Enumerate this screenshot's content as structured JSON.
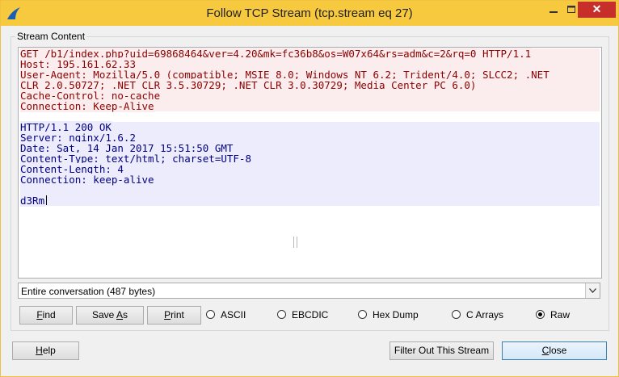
{
  "window": {
    "title": "Follow TCP Stream (tcp.stream eq 27)",
    "close_glyph": "✕",
    "accent": "#f7c93e",
    "close_color": "#c7302a"
  },
  "stream": {
    "group_label": "Stream Content",
    "client_color": "#8b0000",
    "server_color": "#000080",
    "client_lines": [
      "GET /b1/index.php?uid=69868464&ver=4.20&mk=fc36b8&os=W07x64&rs=adm&c=2&rq=0 HTTP/1.1",
      "Host: 195.161.62.33",
      "User-Agent: Mozilla/5.0 (compatible; MSIE 8.0; Windows NT 6.2; Trident/4.0; SLCC2; .NET",
      "CLR 2.0.50727; .NET CLR 3.5.30729; .NET CLR 3.0.30729; Media Center PC 6.0)",
      "Cache-Control: no-cache",
      "Connection: Keep-Alive"
    ],
    "server_lines": [
      "HTTP/1.1 200 OK",
      "Server: nginx/1.6.2",
      "Date: Sat, 14 Jan 2017 15:51:50 GMT",
      "Content-Type: text/html; charset=UTF-8",
      "Content-Length: 4",
      "Connection: keep-alive"
    ],
    "server_body": "d3Rm"
  },
  "conversation_select": {
    "value": "Entire conversation (487 bytes)"
  },
  "buttons": {
    "find": {
      "pre": "",
      "key": "F",
      "post": "ind"
    },
    "save_as": {
      "pre": "Save ",
      "key": "A",
      "post": "s"
    },
    "print": {
      "pre": "",
      "key": "P",
      "post": "rint"
    },
    "help": {
      "pre": "",
      "key": "H",
      "post": "elp"
    },
    "filter_out": "Filter Out This Stream",
    "close": {
      "pre": "",
      "key": "C",
      "post": "lose"
    }
  },
  "format_options": [
    {
      "label": "ASCII",
      "checked": false
    },
    {
      "label": "EBCDIC",
      "checked": false
    },
    {
      "label": "Hex Dump",
      "checked": false
    },
    {
      "label": "C Arrays",
      "checked": false
    },
    {
      "label": "Raw",
      "checked": true
    }
  ]
}
